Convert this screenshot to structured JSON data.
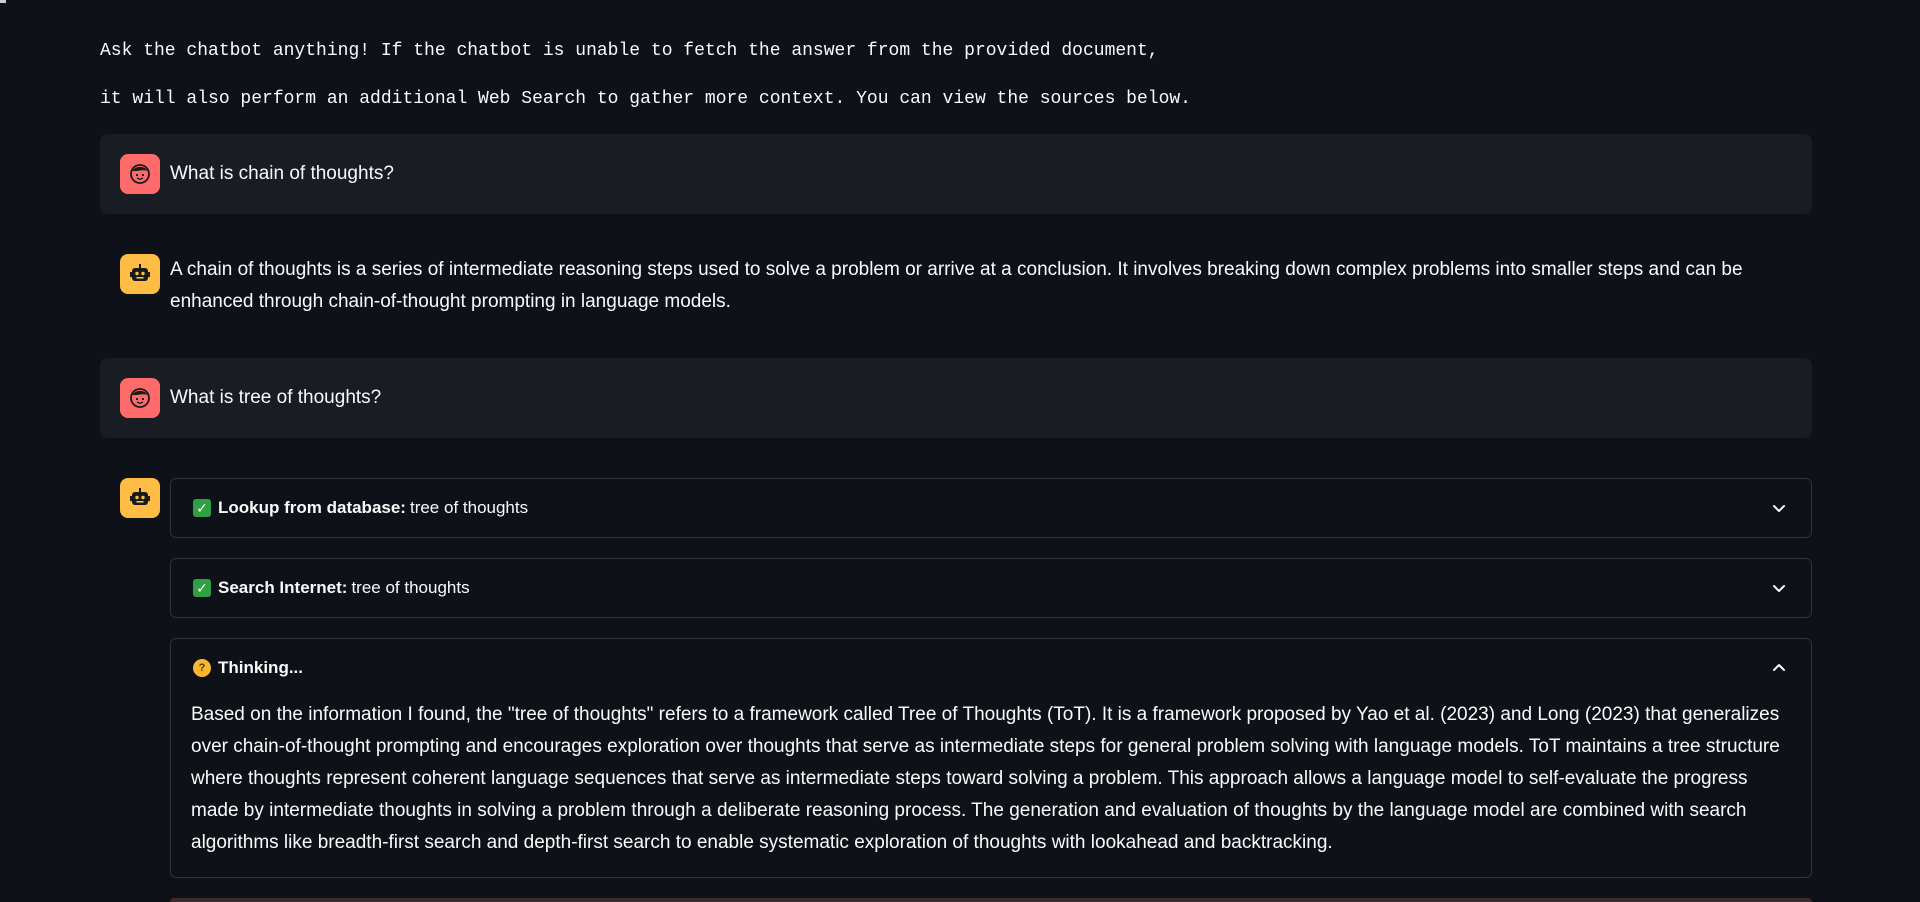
{
  "intro": {
    "line1": "Ask the chatbot anything! If the chatbot is unable to fetch the answer from the provided document,",
    "line2": "it will also perform an additional Web Search to gather more context. You can view the sources below."
  },
  "messages": [
    {
      "role": "user",
      "text": "What is chain of thoughts?"
    },
    {
      "role": "assistant",
      "text": "A chain of thoughts is a series of intermediate reasoning steps used to solve a problem or arrive at a conclusion. It involves breaking down complex problems into smaller steps and can be enhanced through chain-of-thought prompting in language models."
    },
    {
      "role": "user",
      "text": "What is tree of thoughts?"
    }
  ],
  "steps": [
    {
      "icon": "check-icon",
      "label": "Lookup from database:",
      "value": "tree of thoughts",
      "expanded": false
    },
    {
      "icon": "check-icon",
      "label": "Search Internet:",
      "value": "tree of thoughts",
      "expanded": false
    },
    {
      "icon": "thinking-face-icon",
      "label": "Thinking...",
      "value": "",
      "expanded": true,
      "body": "Based on the information I found, the \"tree of thoughts\" refers to a framework called Tree of Thoughts (ToT). It is a framework proposed by Yao et al. (2023) and Long (2023) that generalizes over chain-of-thought prompting and encourages exploration over thoughts that serve as intermediate steps for general problem solving with language models. ToT maintains a tree structure where thoughts represent coherent language sequences that serve as intermediate steps toward solving a problem. This approach allows a language model to self-evaluate the progress made by intermediate thoughts in solving a problem through a deliberate reasoning process. The generation and evaluation of thoughts by the language model are combined with search algorithms like breadth-first search and depth-first search to enable systematic exploration of thoughts with lookahead and backtracking."
    }
  ],
  "colors": {
    "background": "#0e1117",
    "user_bubble": "#1a1c24",
    "user_avatar": "#ff6b6b",
    "assistant_avatar": "#ffbd45",
    "border": "#31333f",
    "check": "#2ea043"
  }
}
